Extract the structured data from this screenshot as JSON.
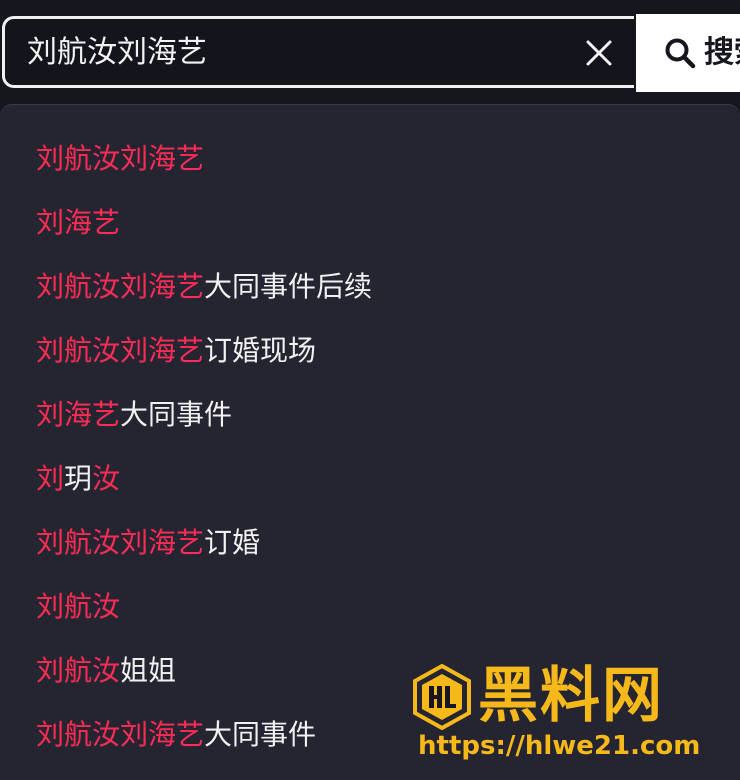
{
  "search": {
    "query": "刘航汝刘海艺",
    "clear_icon": "close-icon",
    "button_label": "搜索",
    "button_icon": "search-icon"
  },
  "suggestions": [
    {
      "highlight": "刘航汝刘海艺",
      "rest": ""
    },
    {
      "highlight": "刘海艺",
      "rest": ""
    },
    {
      "highlight": "刘航汝刘海艺",
      "rest": "大同事件后续"
    },
    {
      "highlight": "刘航汝刘海艺",
      "rest": "订婚现场"
    },
    {
      "highlight": "刘海艺",
      "rest": "大同事件"
    },
    {
      "highlight": "刘",
      "rest": "玥",
      "highlight2": "汝"
    },
    {
      "highlight": "刘航汝刘海艺",
      "rest": "订婚"
    },
    {
      "highlight": "刘航汝",
      "rest": ""
    },
    {
      "highlight": "刘航汝",
      "rest": "姐姐"
    },
    {
      "highlight": "刘航汝刘海艺",
      "rest": "大同事件"
    }
  ],
  "watermark": {
    "name": "黑料网",
    "url": "https://hlwe21.com",
    "logo_icon": "hl-logo-icon"
  },
  "colors": {
    "highlight": "#fe2c55",
    "text": "#f1f1f1",
    "dropdown_bg": "#252532",
    "page_bg": "#16161f",
    "watermark": "#f7b819"
  }
}
